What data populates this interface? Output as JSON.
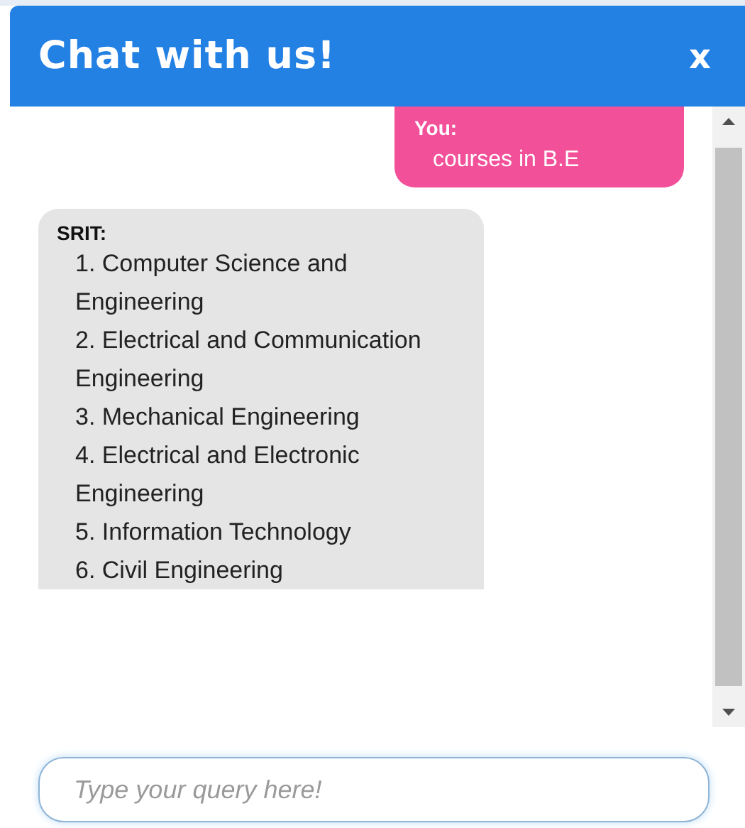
{
  "header": {
    "title": "Chat with us!",
    "close": "x"
  },
  "messages": [
    {
      "kind": "user",
      "sender": "You:",
      "text": "courses in B.E"
    },
    {
      "kind": "bot",
      "sender": "SRIT:",
      "items": [
        "1. Computer Science and Engineering",
        "2. Electrical and Communication Engineering",
        "3. Mechanical Engineering",
        "4. Electrical and Electronic Engineering",
        "5. Information Technology",
        "6. Civil Engineering"
      ]
    }
  ],
  "input": {
    "placeholder": "Type your query here!"
  }
}
